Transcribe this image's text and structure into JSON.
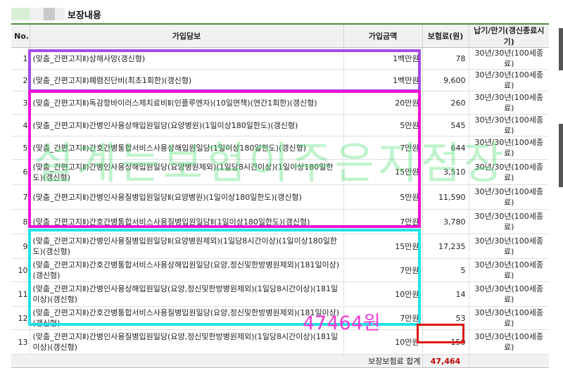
{
  "section": {
    "title": "보장내용"
  },
  "table": {
    "headers": [
      "No.",
      "가입담보",
      "가입금액",
      "보험료(원)",
      "납기/만기(갱신종료시기)"
    ],
    "rows": [
      {
        "no": "1",
        "coverage": "(맞춤_간편고지Ⅱ)상해사망(갱신형)",
        "amount": "1백만원",
        "premium": "78",
        "period": "30년/30년(100세종료)"
      },
      {
        "no": "2",
        "coverage": "(맞춤_간편고지Ⅱ)폐렴진단비(최초1회한)(갱신형)",
        "amount": "1백만원",
        "premium": "9,600",
        "period": "30년/30년(100세종료)"
      },
      {
        "no": "3",
        "coverage": "(맞춤_간편고지Ⅱ)독감항바이러스제치료비Ⅱ(인플루엔자)(10일면책)(연간1회한)(갱신형)",
        "amount": "20만원",
        "premium": "260",
        "period": "30년/30년(100세종료)"
      },
      {
        "no": "4",
        "coverage": "(맞춤_간편고지Ⅱ)간병인사용상해입원일당(요양병원)(1일이상180일한도)(갱신형)",
        "amount": "5만원",
        "premium": "545",
        "period": "30년/30년(100세종료)"
      },
      {
        "no": "5",
        "coverage": "(맞춤_간편고지Ⅱ)간호간병통합서비스사용상해입원일당(1일이상180일한도)(갱신형)",
        "amount": "7만원",
        "premium": "644",
        "period": "30년/30년(100세종료)"
      },
      {
        "no": "6",
        "coverage": "(맞춤_간편고지Ⅱ)간병인사용상해입원일당(요양병원제외)(1일당8시간이상)(1일이상180일한도)(갱신형)",
        "amount": "15만원",
        "premium": "3,510",
        "period": "30년/30년(100세종료)"
      },
      {
        "no": "7",
        "coverage": "(맞춤_간편고지Ⅱ)간병인사용질병입원일당Ⅱ(요양병원)(1일이상180일한도)(갱신형)",
        "amount": "5만원",
        "premium": "11,590",
        "period": "30년/30년(100세종료)"
      },
      {
        "no": "8",
        "coverage": "(맞춤_간편고지Ⅱ)간호간병통합서비스사용질병입원일당Ⅱ(1일이상180일한도)(갱신형)",
        "amount": "7만원",
        "premium": "3,780",
        "period": "30년/30년(100세종료)"
      },
      {
        "no": "9",
        "coverage": "(맞춤_간편고지Ⅱ)간병인사용질병입원일당Ⅱ(요양병원제외)(1일당8시간이상)(1일이상180일한도)(갱신형)",
        "amount": "15만원",
        "premium": "17,235",
        "period": "30년/30년(100세종료)"
      },
      {
        "no": "10",
        "coverage": "(맞춤_간편고지Ⅱ)간호간병통합서비스사용상해입원일당(요양,정신및한방병원제외)(181일이상)(갱신형)",
        "amount": "7만원",
        "premium": "5",
        "period": "30년/30년(100세종료)"
      },
      {
        "no": "11",
        "coverage": "(맞춤_간편고지Ⅱ)간병인사용상해입원일당(요양,정신및한방병원제외)(1일당8시간이상)(181일이상)(갱신형)",
        "amount": "10만원",
        "premium": "14",
        "period": "30년/30년(100세종료)"
      },
      {
        "no": "12",
        "coverage": "(맞춤_간편고지Ⅱ)간호간병통합서비스사용질병입원일당(요양,정신및한방병원제외)(181일이상)(갱신형)",
        "amount": "7만원",
        "premium": "53",
        "period": "30년/30년(100세종료)"
      },
      {
        "no": "13",
        "coverage": "(맞춤_간편고지Ⅱ)간병인사용질병입원일당(요양,정신및한방병원제외)(1일당8시간이상)(181일이상)(갱신형)",
        "amount": "10만원",
        "premium": "150",
        "period": "30년/30년(100세종료)"
      }
    ],
    "total": {
      "label": "보장보험료 합계",
      "value": "47,464"
    }
  },
  "overlays": {
    "watermark": "설계는보험이주은지점장",
    "handwritten_total": "47464원",
    "colors": {
      "purple": "#a64be8",
      "magenta": "#ea14d5",
      "cyan": "#22e3e8",
      "red": "#e01515",
      "header_green": "#4c8c3f"
    }
  }
}
